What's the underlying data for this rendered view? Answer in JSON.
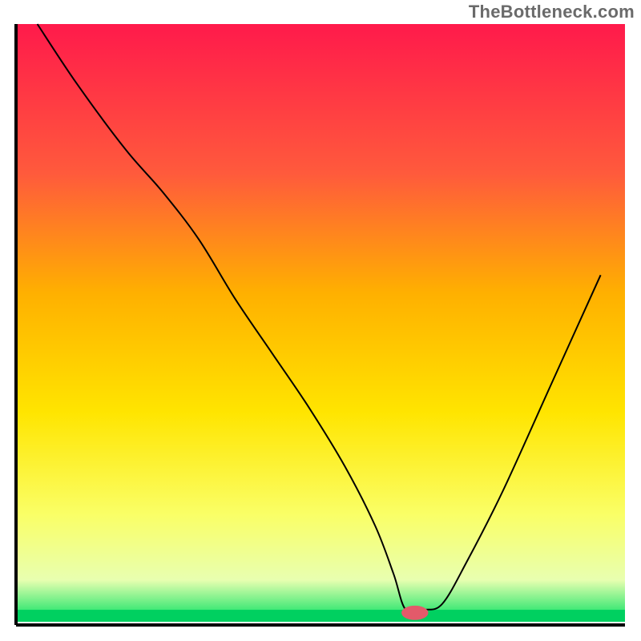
{
  "watermark": {
    "text": "TheBottleneck.com"
  },
  "chart_data": {
    "type": "line",
    "title": "",
    "xlabel": "",
    "ylabel": "",
    "xlim": [
      0,
      100
    ],
    "ylim": [
      0,
      100
    ],
    "grid": false,
    "legend": false,
    "background_gradient": {
      "stops": [
        {
          "offset": 0.0,
          "color": "#ff1a4b"
        },
        {
          "offset": 0.25,
          "color": "#ff5a3c"
        },
        {
          "offset": 0.45,
          "color": "#ffb000"
        },
        {
          "offset": 0.65,
          "color": "#ffe500"
        },
        {
          "offset": 0.82,
          "color": "#faff66"
        },
        {
          "offset": 0.93,
          "color": "#e8ffb0"
        },
        {
          "offset": 1.0,
          "color": "#00e060"
        }
      ]
    },
    "baseline_band": {
      "color": "#00d060",
      "from_y": 0,
      "to_y": 2
    },
    "marker": {
      "x": 65.5,
      "y": 1.5,
      "rx": 2.2,
      "ry": 1.2,
      "color": "#e35a6a"
    },
    "series": [
      {
        "name": "bottleneck-curve",
        "color": "#000000",
        "width": 2,
        "x": [
          3.5,
          10,
          18,
          24,
          30,
          36,
          42,
          48,
          54,
          59,
          62,
          64,
          67,
          70,
          74,
          80,
          88,
          96
        ],
        "values": [
          100,
          90,
          79,
          72,
          64,
          54,
          45,
          36,
          26,
          16,
          8,
          2,
          2,
          3,
          10,
          22,
          40,
          58
        ]
      }
    ]
  }
}
